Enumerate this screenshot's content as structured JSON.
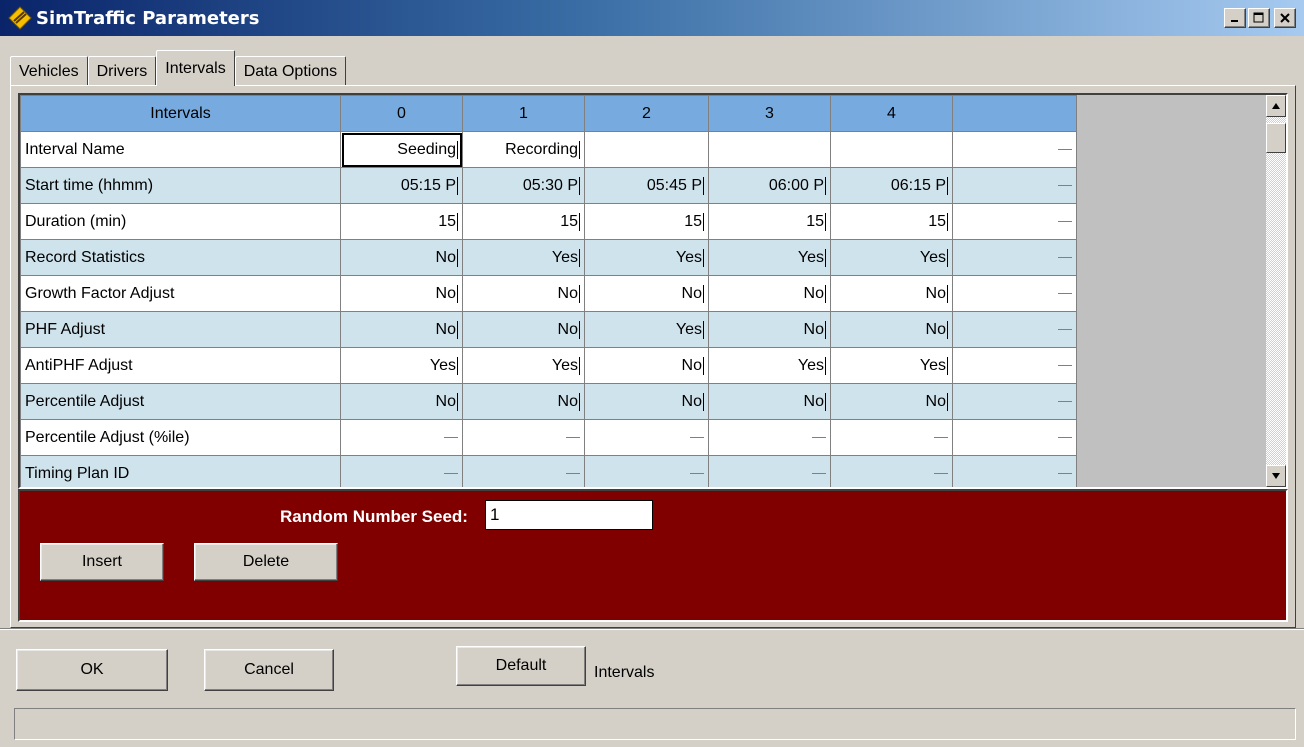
{
  "window": {
    "title": "SimTraffic Parameters",
    "min_label": "_",
    "max_label": "□",
    "close_label": "×"
  },
  "tabs": [
    {
      "label": "Vehicles"
    },
    {
      "label": "Drivers"
    },
    {
      "label": "Intervals",
      "active": true
    },
    {
      "label": "Data Options"
    }
  ],
  "grid": {
    "header": [
      "Intervals",
      "0",
      "1",
      "2",
      "3",
      "4",
      ""
    ],
    "rows": [
      {
        "label": "Interval Name",
        "cells": [
          "Seeding",
          "Recording",
          "",
          "",
          "",
          "—"
        ]
      },
      {
        "label": "Start time (hhmm)",
        "cells": [
          "05:15 P",
          "05:30 P",
          "05:45 P",
          "06:00 P",
          "06:15 P",
          "—"
        ]
      },
      {
        "label": "Duration (min)",
        "cells": [
          "15",
          "15",
          "15",
          "15",
          "15",
          "—"
        ]
      },
      {
        "label": "Record Statistics",
        "cells": [
          "No",
          "Yes",
          "Yes",
          "Yes",
          "Yes",
          "—"
        ]
      },
      {
        "label": "Growth Factor Adjust",
        "cells": [
          "No",
          "No",
          "No",
          "No",
          "No",
          "—"
        ]
      },
      {
        "label": "PHF Adjust",
        "cells": [
          "No",
          "No",
          "Yes",
          "No",
          "No",
          "—"
        ]
      },
      {
        "label": "AntiPHF Adjust",
        "cells": [
          "Yes",
          "Yes",
          "No",
          "Yes",
          "Yes",
          "—"
        ]
      },
      {
        "label": "Percentile Adjust",
        "cells": [
          "No",
          "No",
          "No",
          "No",
          "No",
          "—"
        ]
      },
      {
        "label": "Percentile Adjust (%ile)",
        "cells": [
          "—",
          "—",
          "—",
          "—",
          "—",
          "—"
        ]
      },
      {
        "label": "Timing Plan ID",
        "cells": [
          "—",
          "—",
          "—",
          "—",
          "—",
          "—"
        ]
      }
    ]
  },
  "seed": {
    "label": "Random Number Seed:",
    "value": "1"
  },
  "buttons": {
    "insert": "Insert",
    "delete": "Delete",
    "ok": "OK",
    "cancel": "Cancel",
    "default": "Default"
  },
  "default_context_label": "Intervals",
  "colors": {
    "header": "#77abe0",
    "band": "#cfe3ed",
    "panel": "#800000"
  }
}
